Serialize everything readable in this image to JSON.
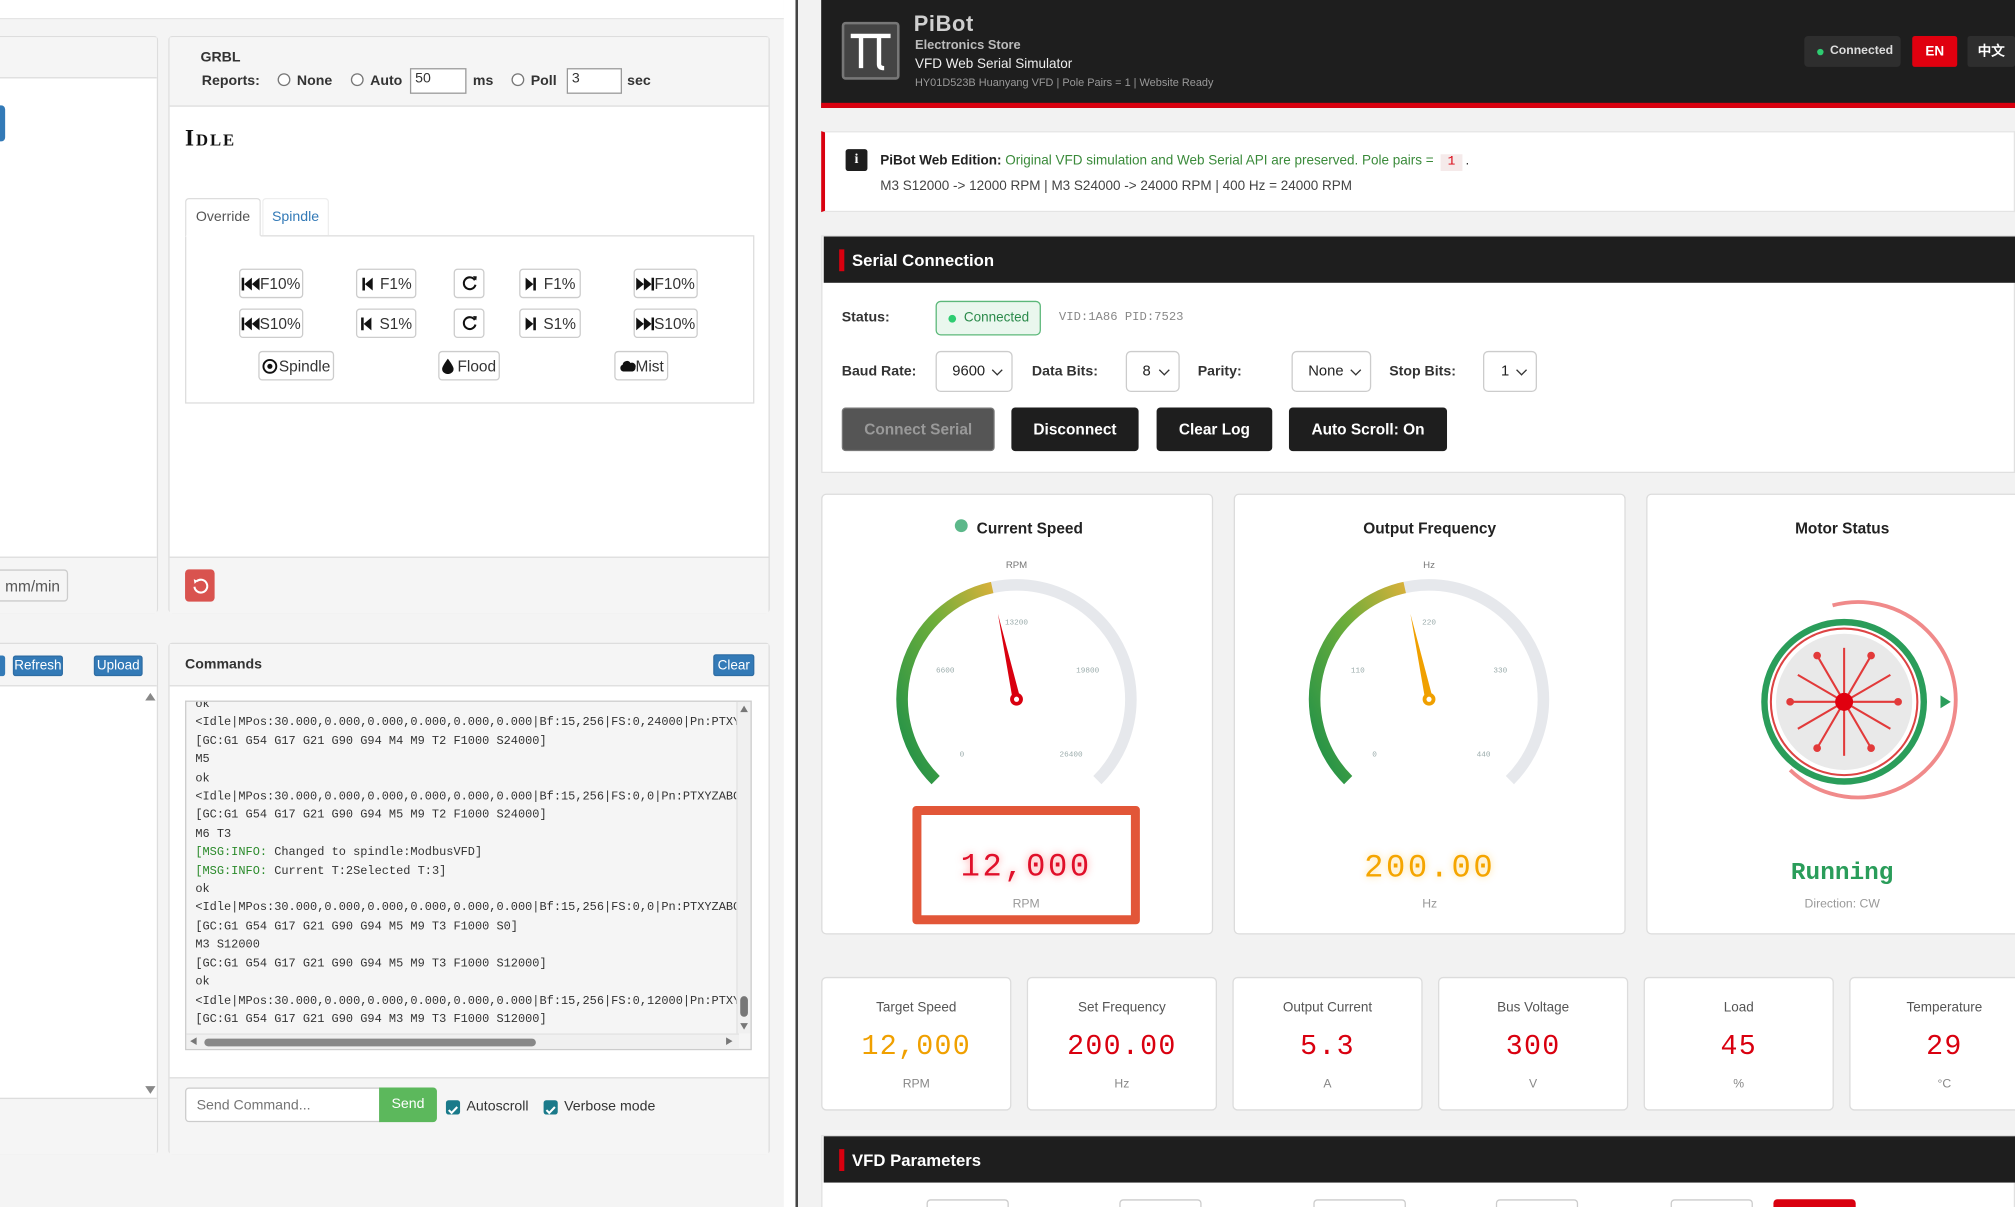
{
  "grbl": {
    "title": "GRBL",
    "reports_label": "Reports:",
    "opt_none": "None",
    "opt_auto": "Auto",
    "auto_value": "50",
    "auto_unit": "ms",
    "opt_poll": "Poll",
    "poll_value": "3",
    "poll_unit": "sec",
    "state": "Idle",
    "tabs": [
      "Override",
      "Spindle"
    ],
    "override": {
      "row1": [
        "F10%",
        "F1%",
        "F1%",
        "F10%"
      ],
      "row2": [
        "S10%",
        "S1%",
        "S1%",
        "S10%"
      ],
      "spindle": "Spindle",
      "flood": "Flood",
      "mist": "Mist"
    },
    "feed_unit": "mm/min"
  },
  "files": {
    "refresh": "Refresh",
    "upload": "Upload"
  },
  "commands": {
    "title": "Commands",
    "clear": "Clear",
    "log": [
      "ok",
      "<Idle|MPos:30.000,0.000,0.000,0.000,0.000,0.000|Bf:15,256|FS:0,24000|Pn:PTXY",
      "[GC:G1 G54 G17 G21 G90 G94 M4 M9 T2 F1000 S24000]",
      "M5",
      "ok",
      "<Idle|MPos:30.000,0.000,0.000,0.000,0.000,0.000|Bf:15,256|FS:0,0|Pn:PTXYZABC",
      "[GC:G1 G54 G17 G21 G90 G94 M5 M9 T2 F1000 S24000]",
      "M6 T3",
      "[MSG:INFO: Changed to spindle:ModbusVFD]",
      "[MSG:INFO: Current T:2Selected T:3]",
      "ok",
      "<Idle|MPos:30.000,0.000,0.000,0.000,0.000,0.000|Bf:15,256|FS:0,0|Pn:PTXYZABC",
      "[GC:G1 G54 G17 G21 G90 G94 M5 M9 T3 F1000 S0]",
      "M3 S12000",
      "[GC:G1 G54 G17 G21 G90 G94 M5 M9 T3 F1000 S12000]",
      "ok",
      "<Idle|MPos:30.000,0.000,0.000,0.000,0.000,0.000|Bf:15,256|FS:0,12000|Pn:PTXY",
      "[GC:G1 G54 G17 G21 G90 G94 M3 M9 T3 F1000 S12000]"
    ],
    "placeholder": "Send Command...",
    "send": "Send",
    "autoscroll": "Autoscroll",
    "verbose": "Verbose mode"
  },
  "pibot": {
    "brand": "PiBot",
    "store": "Electronics Store",
    "subtitle": "VFD Web Serial Simulator",
    "info": "HY01D523B Huanyang VFD | Pole Pairs = 1 | Website Ready",
    "status": "Connected",
    "lang_en": "EN",
    "lang_zh": "中文",
    "notice_bold": "PiBot Web Edition:",
    "notice_text": "Original VFD simulation and Web Serial API are preserved. Pole pairs =",
    "notice_pole": "1",
    "notice_dot": ".",
    "notice_line2": "M3 S12000 -> 12000 RPM | M3 S24000 -> 24000 RPM | 400 Hz = 24000 RPM"
  },
  "serial": {
    "title": "Serial Connection",
    "status_label": "Status:",
    "status_value": "Connected",
    "vidpid": "VID:1A86 PID:7523",
    "baud_label": "Baud Rate:",
    "baud": "9600",
    "data_label": "Data Bits:",
    "data": "8",
    "parity_label": "Parity:",
    "parity": "None",
    "stop_label": "Stop Bits:",
    "stop": "1",
    "btn_connect": "Connect Serial",
    "btn_disconnect": "Disconnect",
    "btn_clear": "Clear Log",
    "btn_autoscroll": "Auto Scroll: On"
  },
  "gauges": {
    "speed": {
      "title": "Current Speed",
      "unit_top": "RPM",
      "ticks": [
        "0",
        "6600",
        "13200",
        "19800",
        "26400"
      ],
      "value": "12,000",
      "unit": "RPM",
      "level": 0.4545
    },
    "freq": {
      "title": "Output Frequency",
      "unit_top": "Hz",
      "ticks": [
        "0",
        "110",
        "220",
        "330",
        "440"
      ],
      "value": "200.00",
      "unit": "Hz",
      "level": 0.4545
    },
    "motor": {
      "title": "Motor Status",
      "state": "Running",
      "direction": "Direction: CW"
    }
  },
  "stats": [
    {
      "label": "Target Speed",
      "value": "12,000",
      "unit": "RPM",
      "color": "#f0a000"
    },
    {
      "label": "Set Frequency",
      "value": "200.00",
      "unit": "Hz",
      "color": "#d9000f"
    },
    {
      "label": "Output Current",
      "value": "5.3",
      "unit": "A",
      "color": "#d9000f"
    },
    {
      "label": "Bus Voltage",
      "value": "300",
      "unit": "V",
      "color": "#d9000f"
    },
    {
      "label": "Load",
      "value": "45",
      "unit": "%",
      "color": "#d9000f"
    },
    {
      "label": "Temperature",
      "value": "29",
      "unit": "°C",
      "color": "#d9000f"
    }
  ],
  "vfd": {
    "title": "VFD Parameters"
  },
  "colors": {
    "accent_red": "#d9000f",
    "dark": "#1e1e1e",
    "green": "#2a9d5a",
    "amber": "#f0a000",
    "bootstrap_blue": "#337ab7"
  }
}
